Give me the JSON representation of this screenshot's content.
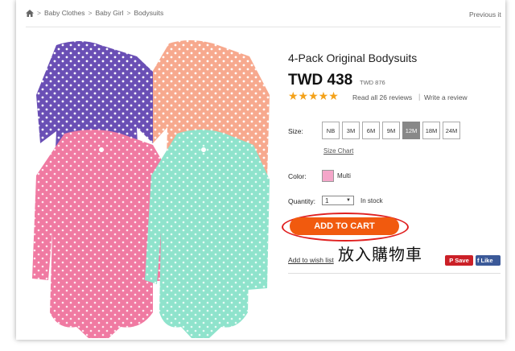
{
  "breadcrumb": {
    "items": [
      "Baby Clothes",
      "Baby Girl",
      "Bodysuits"
    ],
    "separator": ">"
  },
  "nav": {
    "previous": "Previous it"
  },
  "product": {
    "title": "4-Pack Original Bodysuits",
    "price": "TWD 438",
    "price_sub": "TWD 876",
    "rating_stars": "★★★★★",
    "rating": 5,
    "reviews_link": "Read all 26 reviews",
    "write_review": "Write a review"
  },
  "size": {
    "label": "Size:",
    "options": [
      "NB",
      "3M",
      "6M",
      "9M",
      "12M",
      "18M",
      "24M"
    ],
    "selected": "12M",
    "chart_link": "Size Chart"
  },
  "color": {
    "label": "Color:",
    "value": "Multi",
    "swatch": "#f4a6c9"
  },
  "quantity": {
    "label": "Quantity:",
    "value": "1",
    "stock": "In stock"
  },
  "actions": {
    "add_to_cart": "ADD TO CART",
    "annotation": "放入購物車",
    "wishlist": "Add to wish list",
    "pinterest": "Save",
    "facebook": "Like"
  },
  "colors": {
    "cart": "#f15a0e",
    "ring": "#e02020",
    "star": "#f4a21a",
    "pinterest": "#cb2027",
    "facebook": "#3b5998"
  }
}
